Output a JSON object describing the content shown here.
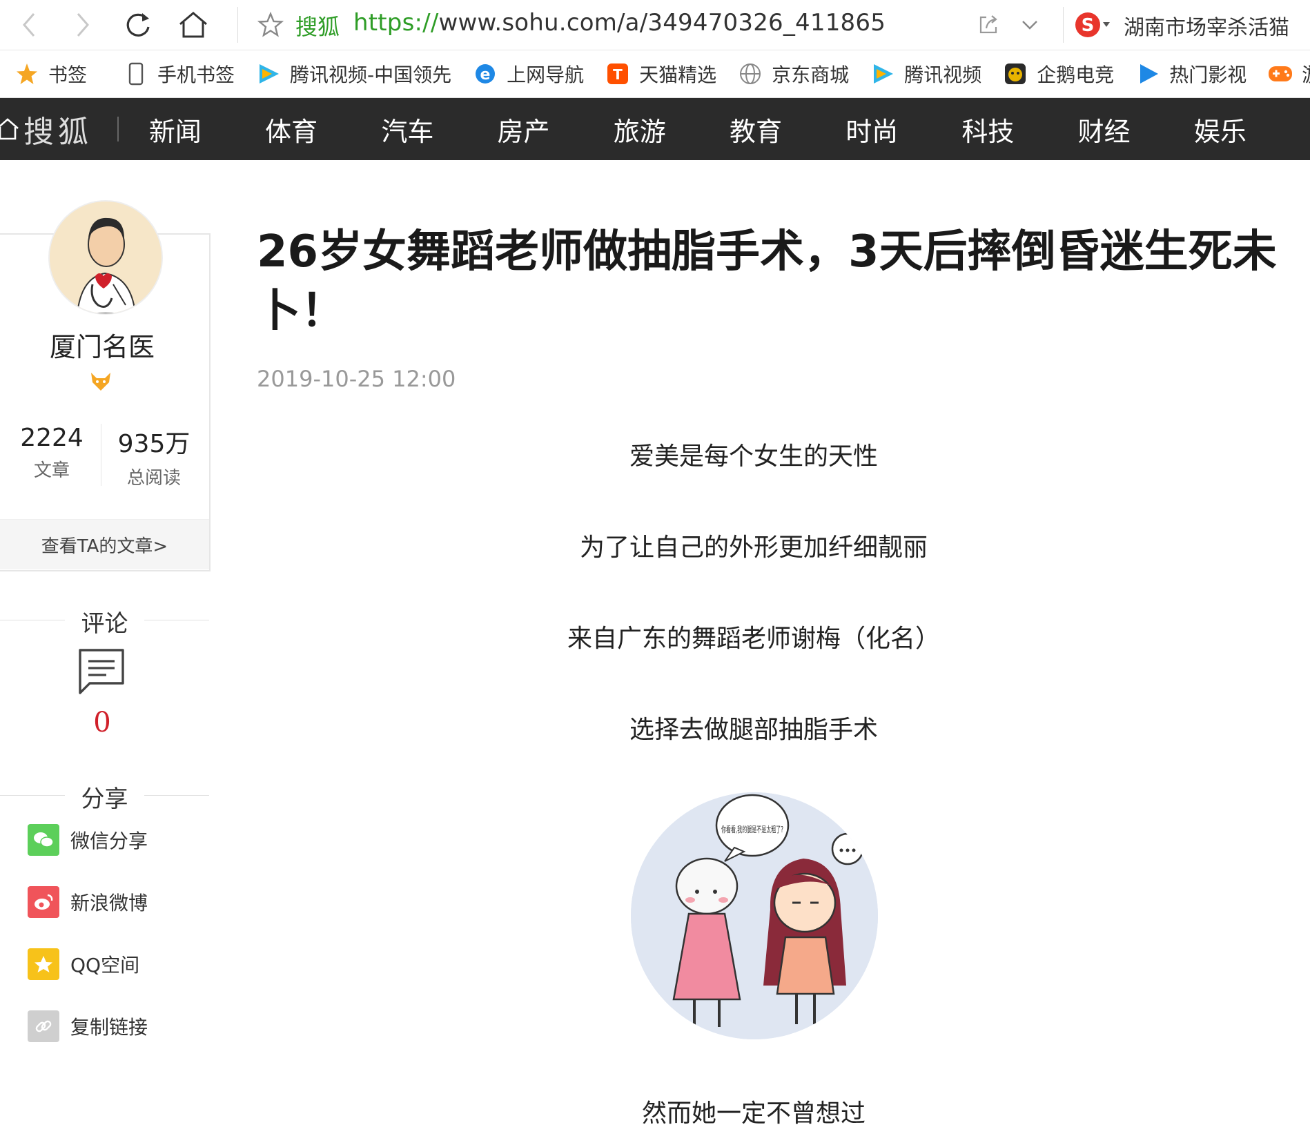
{
  "browser": {
    "site_name": "搜狐",
    "url_scheme": "https://",
    "url_rest": "www.sohu.com/a/349470326_411865",
    "search_text": "湖南市场宰杀活猫",
    "icons": [
      "back-icon",
      "forward-icon",
      "refresh-icon",
      "home-icon",
      "star-icon",
      "share-icon",
      "chevron-down-icon",
      "sogou-icon"
    ]
  },
  "bookmarks": [
    {
      "label": "书签",
      "icon": "star-icon",
      "color": "#f5a623"
    },
    {
      "label": "手机书签",
      "icon": "phone-icon",
      "color": "#555555"
    },
    {
      "label": "腾讯视频-中国领先",
      "icon": "tencent-video-icon",
      "color": "#2fb5e8"
    },
    {
      "label": "上网导航",
      "icon": "ie-icon",
      "color": "#1e88e5"
    },
    {
      "label": "天猫精选",
      "icon": "taobao-icon",
      "color": "#ff5000"
    },
    {
      "label": "京东商城",
      "icon": "globe-icon",
      "color": "#888888"
    },
    {
      "label": "腾讯视频",
      "icon": "tencent-video-icon",
      "color": "#2fb5e8"
    },
    {
      "label": "企鹅电竞",
      "icon": "penguin-icon",
      "color": "#e8b400"
    },
    {
      "label": "热门影视",
      "icon": "play-icon",
      "color": "#1e88e5"
    },
    {
      "label": "游戏中心",
      "icon": "gamepad-icon",
      "color": "#ff7a1a"
    }
  ],
  "site_nav": {
    "logo": "搜狐",
    "items": [
      "新闻",
      "体育",
      "汽车",
      "房产",
      "旅游",
      "教育",
      "时尚",
      "科技",
      "财经",
      "娱乐"
    ]
  },
  "author": {
    "name": "厦门名医",
    "articles_count": "2224",
    "articles_label": "文章",
    "reads_count": "935万",
    "reads_label": "总阅读",
    "view_link": "查看TA的文章>"
  },
  "comments": {
    "title": "评论",
    "count": "0"
  },
  "share": {
    "title": "分享",
    "items": [
      {
        "label": "微信分享",
        "color": "#5ccf5a"
      },
      {
        "label": "新浪微博",
        "color": "#f0545a"
      },
      {
        "label": "QQ空间",
        "color": "#f7c21a"
      },
      {
        "label": "复制链接",
        "color": "#cfcfcf"
      }
    ]
  },
  "article": {
    "title": "26岁女舞蹈老师做抽脂手术，3天后摔倒昏迷生死未卜！",
    "date": "2019-10-25 12:00",
    "paragraphs": [
      "爱美是每个女生的天性",
      "为了让自己的外形更加纤细靓丽",
      "来自广东的舞蹈老师谢梅（化名）",
      "选择去做腿部抽脂手术",
      "然而她一定不曾想过"
    ],
    "illustration_bubble": "你看看,我的腿是不是太粗了?"
  }
}
